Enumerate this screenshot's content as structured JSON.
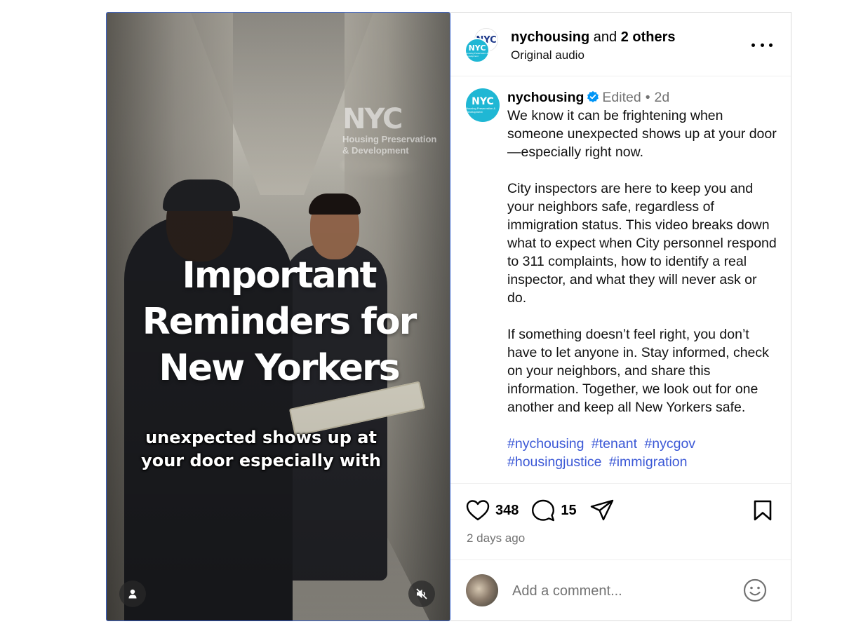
{
  "video": {
    "watermark_logo": "NYC",
    "watermark_line1": "Housing Preservation",
    "watermark_line2": "& Development",
    "overlay_title_lines": [
      "Important",
      "Reminders for",
      "New Yorkers"
    ],
    "caption_lines": [
      "unexpected shows up at",
      "your door especially with"
    ],
    "user_tag_icon": "person-icon",
    "mute_icon": "speaker-muted-icon"
  },
  "header": {
    "avatar_back_text": "NYC",
    "avatar_front_text": "NYC",
    "avatar_front_subtext": "Housing Preservation & Development",
    "username": "nychousing",
    "connector": " and ",
    "others": "2 others",
    "audio": "Original audio",
    "more_icon": "more-horizontal-icon"
  },
  "post": {
    "avatar_text": "NYC",
    "avatar_subtext": "Housing Preservation & Development",
    "username": "nychousing",
    "edited": "Edited",
    "dot": "•",
    "age": "2d",
    "paragraphs": [
      "We know it can be frightening when someone unexpected shows up at your door—especially right now.",
      "City inspectors are here to keep you and your neighbors safe, regardless of immigration status. This video breaks down what to expect when City personnel respond to 311 complaints, how to identify a real inspector, and what they will never ask or do.",
      "If something doesn’t feel right, you don’t have to let anyone in. Stay informed, check on your neighbors, and share this information. Together, we look out for one another and keep all New Yorkers safe."
    ],
    "hashtags": [
      "#nychousing",
      "#tenant",
      "#nycgov",
      "#housingjustice",
      "#immigration"
    ]
  },
  "actions": {
    "likes": "348",
    "comments": "15",
    "time_ago": "2 days ago",
    "icons": [
      "heart-icon",
      "comment-icon",
      "share-icon",
      "bookmark-icon"
    ]
  },
  "comment": {
    "placeholder": "Add a comment...",
    "emoji_icon": "emoji-icon"
  },
  "colors": {
    "link": "#3b58d6",
    "verified": "#0095f6",
    "brand": "#1fb7d4",
    "muted": "#737373"
  }
}
